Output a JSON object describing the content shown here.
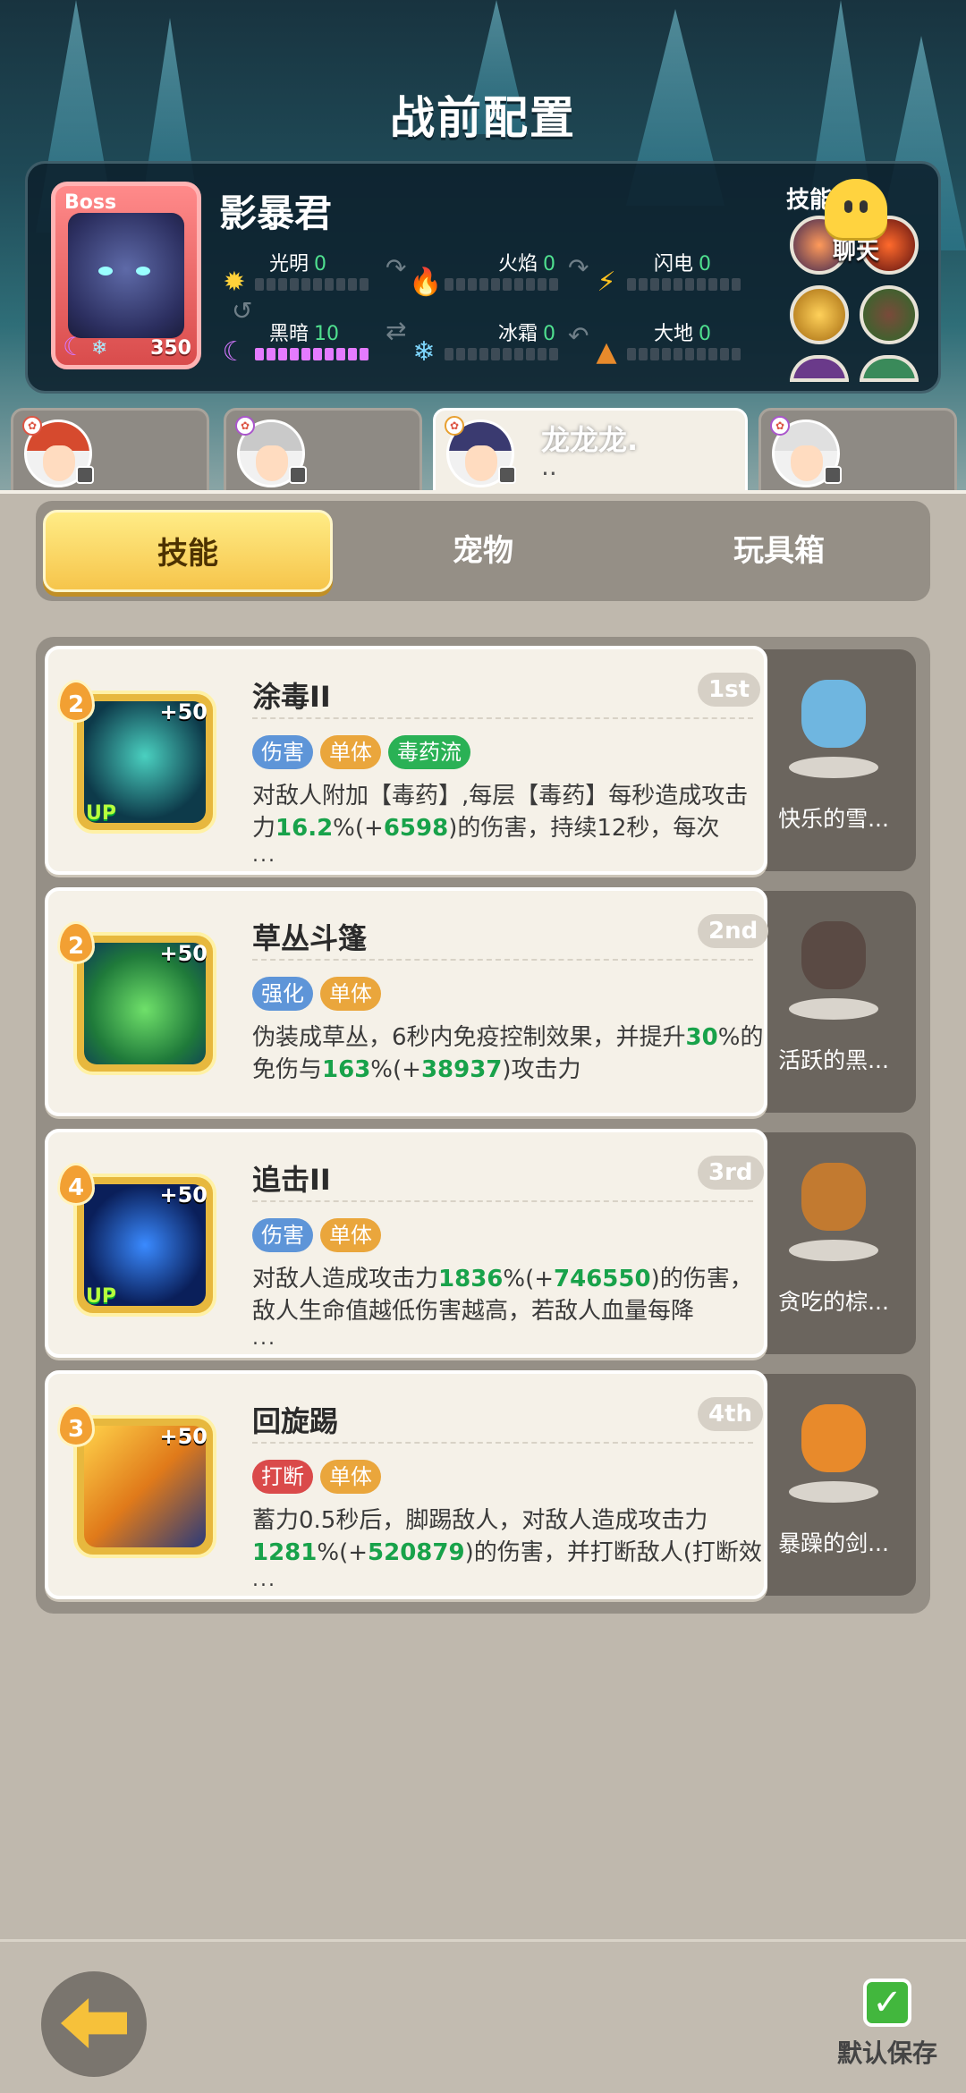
{
  "header": {
    "title": "战前配置"
  },
  "boss": {
    "tag": "Boss",
    "level": "350",
    "name": "影暴君",
    "elements": [
      {
        "name": "光明",
        "value": "0",
        "fill": 0
      },
      {
        "name": "火焰",
        "value": "0",
        "fill": 0
      },
      {
        "name": "闪电",
        "value": "0",
        "fill": 0
      },
      {
        "name": "黑暗",
        "value": "10",
        "fill": 1
      },
      {
        "name": "冰霜",
        "value": "0",
        "fill": 0
      },
      {
        "name": "大地",
        "value": "0",
        "fill": 0
      }
    ],
    "skills_label": "技能"
  },
  "chat": {
    "label": "聊天"
  },
  "characters": [
    {
      "name": ""
    },
    {
      "name": ""
    },
    {
      "name": "龙龙龙.",
      "sub": ".."
    },
    {
      "name": ""
    }
  ],
  "tabs": [
    "技能",
    "宠物",
    "玩具箱"
  ],
  "skills": [
    {
      "name": "涂毒II",
      "rank": "1st",
      "level": "2",
      "plus": "+50",
      "up": "UP",
      "tags": [
        "伤害",
        "单体",
        "毒药流"
      ],
      "desc_a": "对敌人附加【毒药】,每层【毒药】每秒造成攻击力",
      "desc_b": "16.2",
      "desc_c": "%(+",
      "desc_d": "6598",
      "desc_e": ")的伤害，持续12秒，每次",
      "ellipsis": "...",
      "pet": "快乐的雪..."
    },
    {
      "name": "草丛斗篷",
      "rank": "2nd",
      "level": "2",
      "plus": "+50",
      "up": "",
      "tags": [
        "强化",
        "单体"
      ],
      "desc_a": "伪装成草丛，6秒内免疫控制效果，并提升",
      "desc_b": "30",
      "desc_c": "%的免伤与",
      "desc_d": "163",
      "desc_e": "%(+",
      "desc_f": "38937",
      "desc_g": ")攻击力",
      "ellipsis": "",
      "pet": "活跃的黑..."
    },
    {
      "name": "追击II",
      "rank": "3rd",
      "level": "4",
      "plus": "+50",
      "up": "UP",
      "tags": [
        "伤害",
        "单体"
      ],
      "desc_a": "对敌人造成攻击力",
      "desc_b": "1836",
      "desc_c": "%(+",
      "desc_d": "746550",
      "desc_e": ")的伤害，敌人生命值越低伤害越高，若敌人血量每降",
      "ellipsis": "...",
      "pet": "贪吃的棕..."
    },
    {
      "name": "回旋踢",
      "rank": "4th",
      "level": "3",
      "plus": "+50",
      "up": "",
      "tags": [
        "打断",
        "单体"
      ],
      "desc_a": "蓄力0.5秒后，脚踢敌人，对敌人造成攻击力",
      "desc_b": "1281",
      "desc_c": "%(+",
      "desc_d": "520879",
      "desc_e": ")的伤害，并打断敌人(打断效",
      "ellipsis": "...",
      "pet": "暴躁的剑..."
    }
  ],
  "footer": {
    "save_label": "默认保存"
  },
  "colors": {
    "accent": "#f6c54b",
    "green_value": "#18a24a",
    "dark_fill": "#e47bff"
  }
}
